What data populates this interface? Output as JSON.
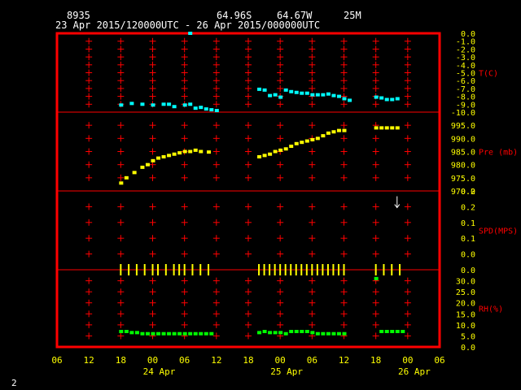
{
  "header": {
    "station": "8935",
    "lat": "64.96S",
    "lon": "64.67W",
    "elev": "25M",
    "range": "23 Apr 2015/120000UTC - 26 Apr 2015/000000UTC"
  },
  "figure_number": "2",
  "colors": {
    "frame": "#ff0000",
    "grid": "#ff0000",
    "axis_text": "#ffff00",
    "label_text": "#ff0000",
    "temp": "#00ffff",
    "pres": "#ffff00",
    "spd": "#ffffff",
    "wind": "#ffff00",
    "rh": "#00ff00"
  },
  "chart_data": {
    "type": "scatter",
    "x_unit": "hours since 23 Apr 2015 06 UTC",
    "x_ticks": [
      "06",
      "12",
      "18",
      "00",
      "06",
      "12",
      "18",
      "00",
      "06",
      "12",
      "18",
      "00",
      "06"
    ],
    "date_labels": [
      {
        "text": "24 Apr",
        "x": 18
      },
      {
        "text": "25 Apr",
        "x": 42
      },
      {
        "text": "26 Apr",
        "x": 66
      }
    ],
    "xlim": [
      0,
      72
    ],
    "panels": [
      {
        "id": "temp",
        "label": "T(C)",
        "ylim": [
          -10.0,
          0.0
        ],
        "tick_labels": [
          "0.0",
          "-1.0",
          "-2.0",
          "-3.0",
          "-4.0",
          "-5.0",
          "-6.0",
          "-7.0",
          "-8.0",
          "-9.0",
          "-10.0"
        ],
        "tick_values": [
          0,
          -1,
          -2,
          -3,
          -4,
          -5,
          -6,
          -7,
          -8,
          -9,
          -10
        ],
        "series": [
          {
            "color_key": "temp",
            "points": [
              [
                12,
                -9.1
              ],
              [
                14,
                -8.9
              ],
              [
                16,
                -9.0
              ],
              [
                18,
                -9.1
              ],
              [
                20,
                -9.0
              ],
              [
                21,
                -9.0
              ],
              [
                22,
                -9.3
              ],
              [
                24,
                -9.1
              ],
              [
                25,
                -9.0
              ],
              [
                26,
                -9.5
              ],
              [
                27,
                -9.4
              ],
              [
                28,
                -9.6
              ],
              [
                29,
                -9.7
              ],
              [
                30,
                -9.8
              ],
              [
                25,
                0.0
              ],
              [
                38,
                -7.1
              ],
              [
                39,
                -7.2
              ],
              [
                40,
                -7.9
              ],
              [
                41,
                -7.8
              ],
              [
                42,
                -8.1
              ],
              [
                43,
                -7.2
              ],
              [
                44,
                -7.4
              ],
              [
                45,
                -7.5
              ],
              [
                46,
                -7.6
              ],
              [
                47,
                -7.6
              ],
              [
                48,
                -7.8
              ],
              [
                49,
                -7.8
              ],
              [
                50,
                -7.8
              ],
              [
                51,
                -7.7
              ],
              [
                52,
                -7.9
              ],
              [
                53,
                -8.0
              ],
              [
                54,
                -8.3
              ],
              [
                55,
                -8.5
              ],
              [
                60,
                -8.1
              ],
              [
                61,
                -8.2
              ],
              [
                62,
                -8.4
              ],
              [
                63,
                -8.4
              ],
              [
                64,
                -8.3
              ]
            ]
          }
        ]
      },
      {
        "id": "pres",
        "label": "Pre (mb)",
        "ylim": [
          970.0,
          1000.0
        ],
        "tick_labels": [
          "995.0",
          "990.0",
          "985.0",
          "980.0",
          "975.0",
          "970.0"
        ],
        "tick_values": [
          995,
          990,
          985,
          980,
          975,
          970
        ],
        "series": [
          {
            "color_key": "pres",
            "points": [
              [
                12,
                973.0
              ],
              [
                13,
                975.0
              ],
              [
                14.5,
                977.0
              ],
              [
                16,
                979.0
              ],
              [
                17,
                980.0
              ],
              [
                18,
                981.5
              ],
              [
                19,
                982.5
              ],
              [
                20,
                983.0
              ],
              [
                21,
                983.5
              ],
              [
                22,
                984.0
              ],
              [
                23,
                984.5
              ],
              [
                24,
                985.0
              ],
              [
                25,
                985.0
              ],
              [
                26,
                985.5
              ],
              [
                27,
                985.0
              ],
              [
                28.5,
                984.8
              ],
              [
                38,
                983.0
              ],
              [
                39,
                983.5
              ],
              [
                40,
                984.0
              ],
              [
                41,
                985.0
              ],
              [
                42,
                985.5
              ],
              [
                43,
                986.0
              ],
              [
                44,
                987.0
              ],
              [
                45,
                988.0
              ],
              [
                46,
                988.5
              ],
              [
                47,
                989.0
              ],
              [
                48,
                989.5
              ],
              [
                49,
                990.0
              ],
              [
                50,
                991.0
              ],
              [
                51,
                992.0
              ],
              [
                52,
                992.5
              ],
              [
                53,
                993.0
              ],
              [
                54,
                993.0
              ],
              [
                60,
                994.0
              ],
              [
                61,
                994.0
              ],
              [
                62,
                994.0
              ],
              [
                63,
                994.0
              ],
              [
                64,
                994.0
              ]
            ]
          }
        ]
      },
      {
        "id": "spd",
        "label": "SPD(MPS)",
        "ylim": [
          0.0,
          0.2
        ],
        "tick_labels": [
          "0.2",
          "0.2",
          "0.1",
          "0.1",
          "0.0",
          "0.0"
        ],
        "tick_values": [
          0.2,
          0.16,
          0.12,
          0.08,
          0.04,
          0.0
        ],
        "wind_arrow": {
          "x": 64,
          "y": 0.17
        },
        "calm_marks_x": [
          12,
          13.5,
          15,
          16.5,
          18,
          19,
          20.5,
          22,
          23,
          24,
          25.5,
          27,
          28.5,
          38,
          39,
          40,
          41,
          42,
          43,
          44,
          45,
          46,
          47,
          48,
          49,
          50,
          51,
          52,
          53,
          54,
          60,
          61.5,
          63,
          64.5
        ]
      },
      {
        "id": "rh",
        "label": "RH(%)",
        "ylim": [
          0.0,
          35.0
        ],
        "tick_labels": [
          "30.0",
          "25.0",
          "20.0",
          "15.0",
          "10.0",
          "5.0",
          "0.0"
        ],
        "tick_values": [
          30,
          25,
          20,
          15,
          10,
          5,
          0
        ],
        "series": [
          {
            "color_key": "rh",
            "points": [
              [
                12,
                7.0
              ],
              [
                13,
                7.0
              ],
              [
                14,
                6.5
              ],
              [
                15,
                6.5
              ],
              [
                16,
                6.0
              ],
              [
                17,
                6.0
              ],
              [
                18,
                6.0
              ],
              [
                19,
                6.0
              ],
              [
                20,
                6.0
              ],
              [
                21,
                6.0
              ],
              [
                22,
                6.0
              ],
              [
                23,
                6.0
              ],
              [
                24,
                6.0
              ],
              [
                25,
                6.0
              ],
              [
                26,
                6.0
              ],
              [
                27,
                6.0
              ],
              [
                28,
                6.0
              ],
              [
                29,
                6.0
              ],
              [
                38,
                6.5
              ],
              [
                39,
                7.0
              ],
              [
                40,
                6.5
              ],
              [
                41,
                6.5
              ],
              [
                42,
                6.5
              ],
              [
                43,
                6.0
              ],
              [
                44,
                7.0
              ],
              [
                45,
                7.0
              ],
              [
                46,
                7.0
              ],
              [
                47,
                7.0
              ],
              [
                48,
                6.5
              ],
              [
                49,
                6.0
              ],
              [
                50,
                6.0
              ],
              [
                51,
                6.0
              ],
              [
                52,
                6.0
              ],
              [
                53,
                6.0
              ],
              [
                54,
                6.0
              ],
              [
                60,
                31.0
              ],
              [
                61,
                7.0
              ],
              [
                62,
                7.0
              ],
              [
                63,
                7.0
              ],
              [
                64,
                7.0
              ],
              [
                65,
                7.0
              ]
            ]
          }
        ]
      }
    ]
  }
}
